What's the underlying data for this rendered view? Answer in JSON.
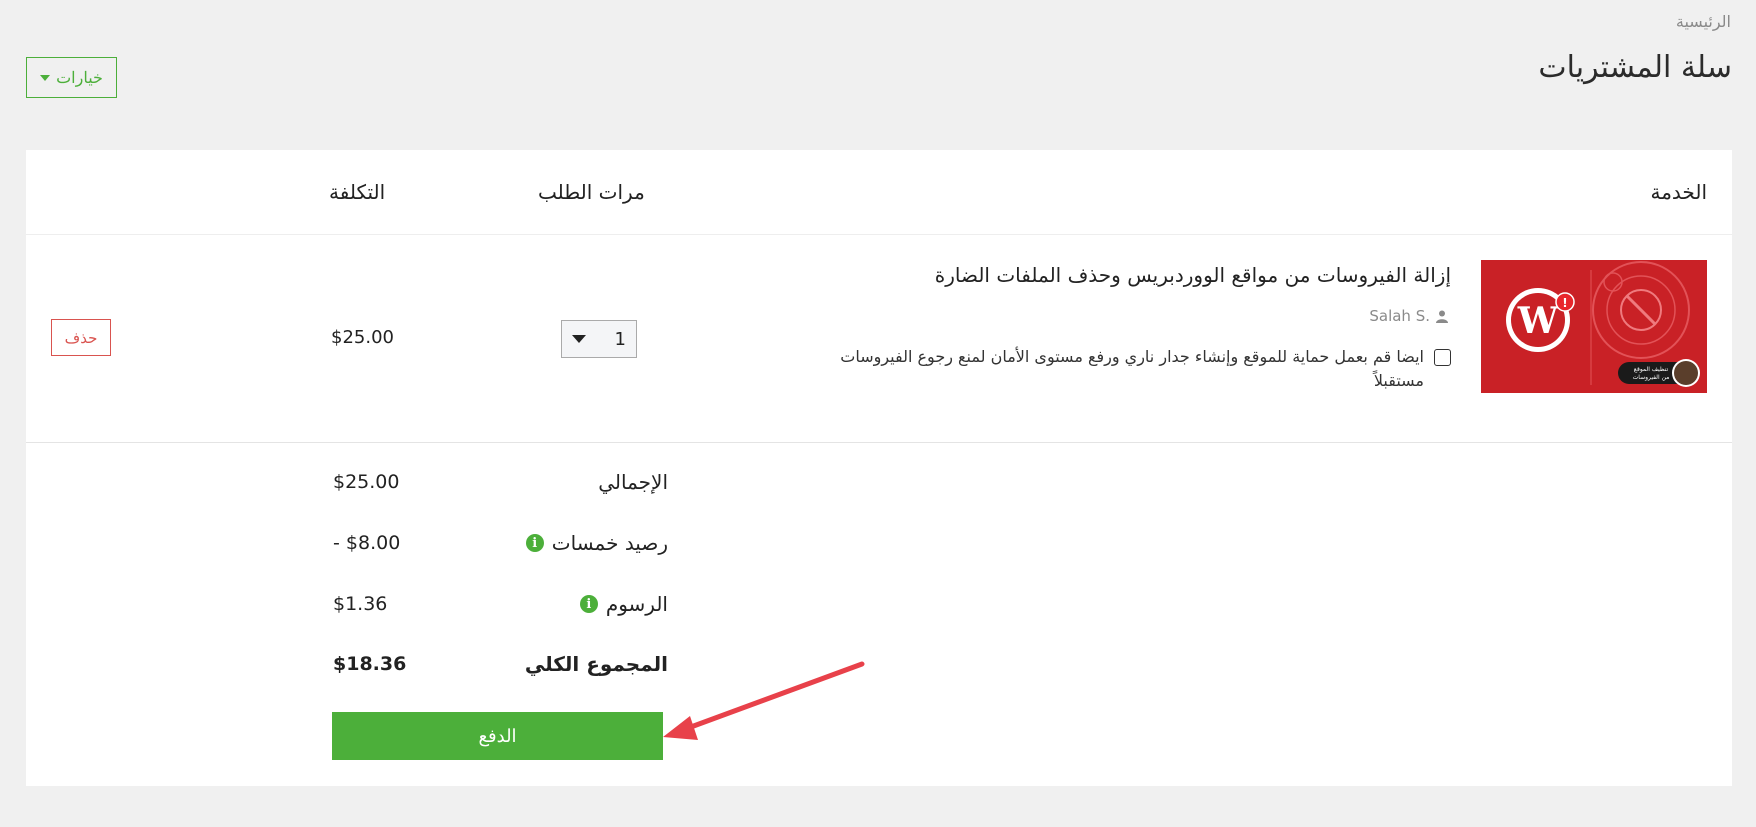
{
  "breadcrumb": "الرئيسية",
  "page_title": "سلة المشتريات",
  "options_button": "خيارات",
  "table": {
    "headers": {
      "service": "الخدمة",
      "quantity": "مرات الطلب",
      "cost": "التكلفة"
    }
  },
  "item": {
    "title": "إزالة الفيروسات من مواقع الووردبريس وحذف الملفات الضارة",
    "seller": "Salah S.",
    "addon": "ايضا قم بعمل حماية للموقع وإنشاء جدار ناري ورفع مستوى الأمان لمنع رجوع الفيروسات مستقبلاً",
    "thumb_caption_1": "تنظيف الموقع",
    "thumb_caption_2": "من الفيروسات",
    "quantity": "1",
    "price": "$25.00",
    "delete_label": "حذف"
  },
  "summary": {
    "subtotal_label": "الإجمالي",
    "subtotal_value": "$25.00",
    "credit_label": "رصيد خمسات",
    "credit_value": "- $8.00",
    "fees_label": "الرسوم",
    "fees_value": "$1.36",
    "total_label": "المجموع الكلي",
    "total_value": "$18.36"
  },
  "pay_button": "الدفع",
  "colors": {
    "accent": "#4caf3a",
    "danger": "#d9534f",
    "thumb_bg": "#c92126",
    "arrow": "#e8414a"
  }
}
